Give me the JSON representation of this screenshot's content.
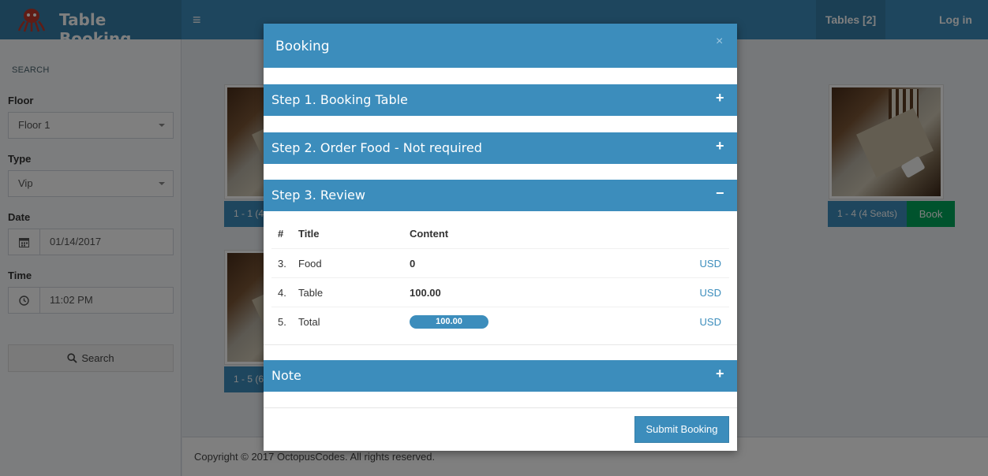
{
  "app": {
    "title": "Table Booking"
  },
  "nav": {
    "tables_label": "Tables [2]",
    "login_label": "Log in"
  },
  "sidebar": {
    "section": "SEARCH",
    "floor": {
      "label": "Floor",
      "value": "Floor 1"
    },
    "type": {
      "label": "Type",
      "value": "Vip"
    },
    "date": {
      "label": "Date",
      "value": "01/14/2017"
    },
    "time": {
      "label": "Time",
      "value": "11:02 PM"
    },
    "search_label": "Search"
  },
  "tables": [
    {
      "label": "1 - 1 (4"
    },
    {
      "label": "1 - 4 (4 Seats)",
      "book_label": "Book"
    },
    {
      "label": "1 - 5 (6"
    }
  ],
  "footer": {
    "text": "Copyright © 2017 OctopusCodes. All rights reserved."
  },
  "modal": {
    "title": "Booking",
    "close": "×",
    "steps": [
      {
        "label": "Step 1. Booking Table",
        "toggle": "+"
      },
      {
        "label": "Step 2. Order Food - Not required",
        "toggle": "+"
      },
      {
        "label": "Step 3. Review",
        "toggle": "−"
      },
      {
        "label": "Note",
        "toggle": "+"
      }
    ],
    "review": {
      "headers": [
        "#",
        "Title",
        "Content"
      ],
      "rows": [
        {
          "num": "3.",
          "title": "Food",
          "content": "0",
          "currency": "USD"
        },
        {
          "num": "4.",
          "title": "Table",
          "content": "100.00",
          "currency": "USD"
        },
        {
          "num": "5.",
          "title": "Total",
          "content": "100.00",
          "currency": "USD"
        }
      ]
    },
    "submit_label": "Submit Booking"
  },
  "colors": {
    "primary": "#3c8dbc",
    "primary_dark": "#367fa9",
    "success": "#00a65a"
  }
}
